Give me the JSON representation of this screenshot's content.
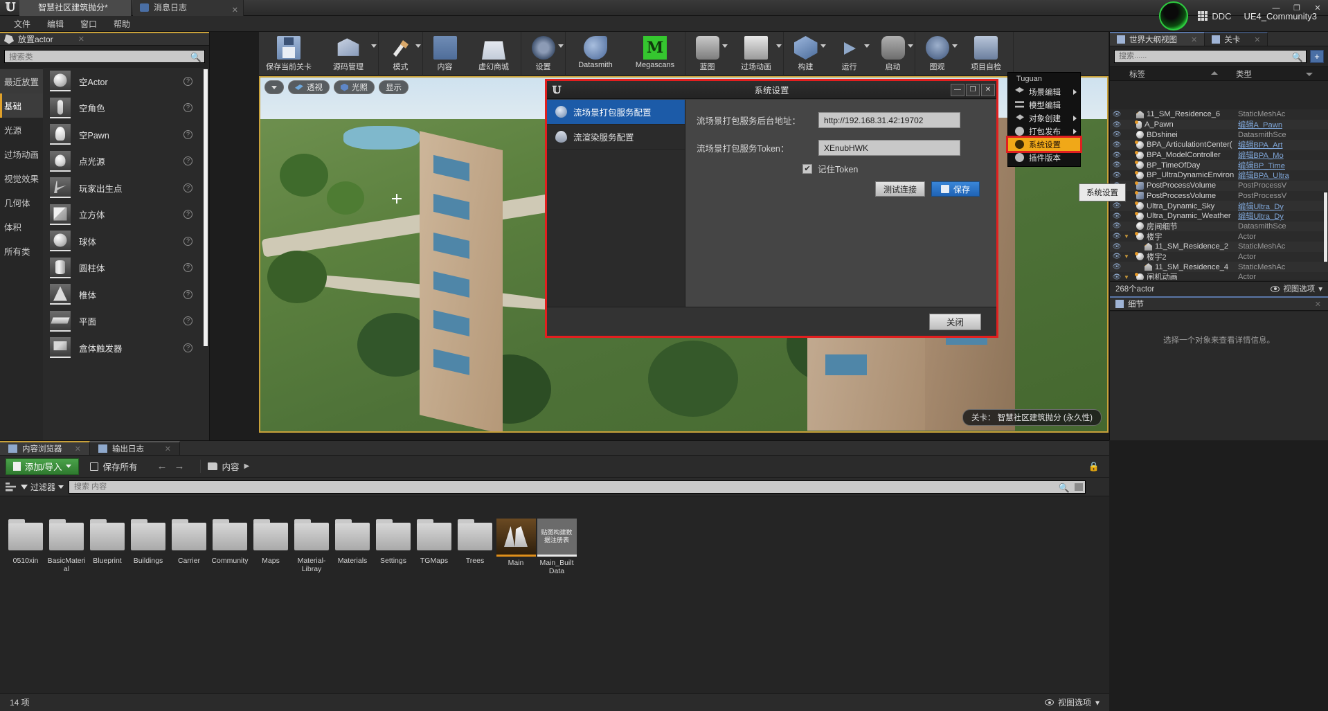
{
  "titlebar": {
    "project_tab": "智慧社区建筑抛分*",
    "log_tab": "消息日志",
    "minimize": "—",
    "maximize": "❐",
    "close": "✕",
    "ddc": "DDC",
    "community_version": "UE4_Community3"
  },
  "menubar": {
    "items": [
      "文件",
      "编辑",
      "窗口",
      "帮助"
    ]
  },
  "place_actor": {
    "tab_label": "放置actor",
    "search_placeholder": "搜索类",
    "categories": [
      "最近放置",
      "基础",
      "光源",
      "过场动画",
      "视觉效果",
      "几何体",
      "体积",
      "所有类"
    ],
    "selected_category": "基础",
    "items": [
      {
        "label": "空Actor",
        "shape": "sphere"
      },
      {
        "label": "空角色",
        "shape": "person"
      },
      {
        "label": "空Pawn",
        "shape": "pawn"
      },
      {
        "label": "点光源",
        "shape": "bulb"
      },
      {
        "label": "玩家出生点",
        "shape": "flag"
      },
      {
        "label": "立方体",
        "shape": "cube"
      },
      {
        "label": "球体",
        "shape": "sphere"
      },
      {
        "label": "圆柱体",
        "shape": "cyl"
      },
      {
        "label": "椎体",
        "shape": "cone"
      },
      {
        "label": "平面",
        "shape": "plane"
      },
      {
        "label": "盒体触发器",
        "shape": "boxtr"
      }
    ]
  },
  "toolbar": {
    "buttons": [
      {
        "label": "保存当前关卡",
        "icon": "save-icon",
        "dropdown": false,
        "wide": true
      },
      {
        "label": "源码管理",
        "icon": "source-control-icon",
        "dropdown": true,
        "wide": true
      },
      {
        "label": "模式",
        "icon": "modes-icon",
        "dropdown": true
      },
      {
        "label": "内容",
        "icon": "content-icon",
        "dropdown": false
      },
      {
        "label": "虚幻商城",
        "icon": "marketplace-icon",
        "dropdown": false,
        "wide2": true
      },
      {
        "label": "设置",
        "icon": "settings-gear-icon",
        "dropdown": true
      },
      {
        "label": "Datasmith",
        "icon": "datasmith-icon",
        "dropdown": false,
        "wide": true
      },
      {
        "label": "Megascans",
        "icon": "megascans-icon",
        "dropdown": false,
        "wide": true
      },
      {
        "label": "蓝图",
        "icon": "blueprint-icon",
        "dropdown": true
      },
      {
        "label": "过场动画",
        "icon": "cinematics-icon",
        "dropdown": true,
        "wide2": true
      },
      {
        "label": "构建",
        "icon": "build-icon",
        "dropdown": true
      },
      {
        "label": "运行",
        "icon": "play-icon",
        "dropdown": true
      },
      {
        "label": "启动",
        "icon": "launch-icon",
        "dropdown": true
      },
      {
        "label": "图观",
        "icon": "tuguan-icon",
        "dropdown": true
      },
      {
        "label": "项目自检",
        "icon": "project-check-icon",
        "dropdown": false,
        "wide2": true
      }
    ]
  },
  "viewport": {
    "dropdown": "▼",
    "perspective": "透视",
    "lit": "光照",
    "show": "显示",
    "level_label": "关卡： 智慧社区建筑抛分 (永久性)"
  },
  "context_menu": {
    "header": "Tuguan",
    "items": [
      {
        "label": "场景编辑",
        "icon": "layers-icon",
        "submenu": true,
        "highlighted": false
      },
      {
        "label": "模型编辑",
        "icon": "model-edit-icon",
        "submenu": false,
        "highlighted": false
      },
      {
        "label": "对象创建",
        "icon": "object-create-icon",
        "submenu": true,
        "highlighted": false
      },
      {
        "label": "打包发布",
        "icon": "package-publish-icon",
        "submenu": true,
        "highlighted": false
      },
      {
        "label": "系统设置",
        "icon": "gear-icon",
        "submenu": false,
        "highlighted": true
      },
      {
        "label": "插件版本",
        "icon": "plugin-version-icon",
        "submenu": false,
        "highlighted": false
      }
    ],
    "tooltip": "系统设置"
  },
  "dialog": {
    "title": "系统设置",
    "window_buttons": {
      "minimize": "—",
      "maximize": "❐",
      "close": "✕"
    },
    "nav": [
      {
        "label": "流场景打包服务配置",
        "icon": "stream-scene-icon",
        "selected": true
      },
      {
        "label": "流渲染服务配置",
        "icon": "stream-render-icon",
        "selected": false
      }
    ],
    "fields": [
      {
        "label": "流场景打包服务后台地址：",
        "value": "http://192.168.31.42:19702"
      },
      {
        "label": "流场景打包服务Token：",
        "value": "XEnubHWK"
      }
    ],
    "checkbox": {
      "label": "记住Token",
      "checked": true,
      "mark": "✔"
    },
    "buttons": {
      "test": "测试连接",
      "save": "保存",
      "close": "关闭"
    }
  },
  "outliner": {
    "tabs": [
      {
        "label": "世界大纲视图",
        "icon": "outliner-icon",
        "active": true
      },
      {
        "label": "关卡",
        "icon": "level-icon",
        "active": false
      }
    ],
    "search_placeholder": "搜索......",
    "add_button": "+",
    "columns": {
      "name": "标签",
      "type": "类型"
    },
    "rows": [
      {
        "name": "11_SM_Residence_6",
        "type": "StaticMeshAc",
        "link": false,
        "indent": 1,
        "icon": "mesh",
        "expand": false
      },
      {
        "name": "A_Pawn",
        "type": "编辑A_Pawn",
        "link": true,
        "indent": 1,
        "icon": "pawn",
        "expand": false
      },
      {
        "name": "BDshinei",
        "type": "DatasmithSce",
        "link": false,
        "indent": 1,
        "icon": "dot",
        "expand": false
      },
      {
        "name": "BPA_ArticulationtCenter(",
        "type": "编辑BPA_Art",
        "link": true,
        "indent": 1,
        "icon": "dot",
        "expand": false
      },
      {
        "name": "BPA_ModelController",
        "type": "编辑BPA_Mo",
        "link": true,
        "indent": 1,
        "icon": "dot",
        "expand": false
      },
      {
        "name": "BP_TimeOfDay",
        "type": "编辑BP_Time",
        "link": true,
        "indent": 1,
        "icon": "dot",
        "expand": false
      },
      {
        "name": "BP_UltraDynamicEnviron",
        "type": "编辑BPA_Ultra",
        "link": true,
        "indent": 1,
        "icon": "dot",
        "expand": false
      },
      {
        "name": "PostProcessVolume",
        "type": "PostProcessV",
        "link": false,
        "indent": 1,
        "icon": "ppv",
        "expand": false
      },
      {
        "name": "PostProcessVolume",
        "type": "PostProcessV",
        "link": false,
        "indent": 1,
        "icon": "ppv",
        "expand": false
      },
      {
        "name": "Ultra_Dynamic_Sky",
        "type": "编辑Ultra_Dy",
        "link": true,
        "indent": 1,
        "icon": "dot",
        "expand": false
      },
      {
        "name": "Ultra_Dynamic_Weather",
        "type": "编辑Ultra_Dy",
        "link": true,
        "indent": 1,
        "icon": "dot",
        "expand": false
      },
      {
        "name": "房间细节",
        "type": "DatasmithSce",
        "link": false,
        "indent": 1,
        "icon": "dot",
        "expand": false
      },
      {
        "name": "楼宇",
        "type": "Actor",
        "link": false,
        "indent": 0,
        "icon": "dot",
        "expand": true
      },
      {
        "name": "11_SM_Residence_2",
        "type": "StaticMeshAc",
        "link": false,
        "indent": 2,
        "icon": "mesh",
        "expand": false
      },
      {
        "name": "楼宇2",
        "type": "Actor",
        "link": false,
        "indent": 0,
        "icon": "dot",
        "expand": true
      },
      {
        "name": "11_SM_Residence_4",
        "type": "StaticMeshAc",
        "link": false,
        "indent": 2,
        "icon": "mesh",
        "expand": false
      },
      {
        "name": "闸机动画",
        "type": "Actor",
        "link": false,
        "indent": 0,
        "icon": "dot",
        "expand": true
      }
    ],
    "footer_count": "268个actor",
    "footer_view_options": "视图选项"
  },
  "details": {
    "tab_label": "细节",
    "empty_message": "选择一个对象来查看详情信息。"
  },
  "content_browser": {
    "tabs": [
      {
        "label": "内容浏览器",
        "active": true
      },
      {
        "label": "输出日志",
        "active": false
      }
    ],
    "add_import": "添加/导入",
    "save_all": "保存所有",
    "path": "内容",
    "filter": "过滤器",
    "search_placeholder": "搜索 内容",
    "items": [
      {
        "label": "0510xin",
        "kind": "folder"
      },
      {
        "label": "BasicMaterial",
        "kind": "folder"
      },
      {
        "label": "Blueprint",
        "kind": "folder"
      },
      {
        "label": "Buildings",
        "kind": "folder"
      },
      {
        "label": "Carrier",
        "kind": "folder"
      },
      {
        "label": "Community",
        "kind": "folder"
      },
      {
        "label": "Maps",
        "kind": "folder"
      },
      {
        "label": "Material-Libray",
        "kind": "folder"
      },
      {
        "label": "Materials",
        "kind": "folder"
      },
      {
        "label": "Settings",
        "kind": "folder"
      },
      {
        "label": "TGMaps",
        "kind": "folder"
      },
      {
        "label": "Trees",
        "kind": "folder"
      },
      {
        "label": "Main",
        "kind": "asset",
        "selected": true
      },
      {
        "label": "Main_Built Data",
        "kind": "asset2",
        "thumb_text": "贴图构建数据注册表"
      }
    ],
    "status_count": "14 项",
    "status_view_options": "视图选项"
  },
  "colors": {
    "accent_blue": "#1c5ba8",
    "accent_orange": "#f0a818",
    "danger_red": "#e21f1f",
    "gold_border": "#c8a13a",
    "green": "#35c72f"
  }
}
